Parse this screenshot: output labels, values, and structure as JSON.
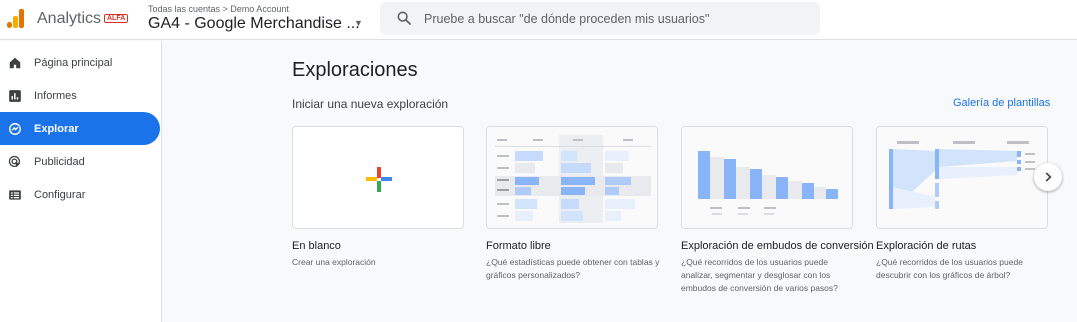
{
  "header": {
    "app_name": "Analytics",
    "badge": "ALFA",
    "breadcrumb": "Todas las cuentas > Demo Account",
    "account": "GA4 - Google Merchandise ...",
    "search_placeholder": "Pruebe a buscar \"de dónde proceden mis usuarios\""
  },
  "sidebar": {
    "items": [
      {
        "label": "Página principal",
        "icon": "home-icon"
      },
      {
        "label": "Informes",
        "icon": "bar-chart-icon"
      },
      {
        "label": "Explorar",
        "icon": "explore-icon",
        "active": true
      },
      {
        "label": "Publicidad",
        "icon": "advertising-icon"
      },
      {
        "label": "Configurar",
        "icon": "settings-list-icon"
      }
    ]
  },
  "main": {
    "title": "Exploraciones",
    "subtitle": "Iniciar una nueva exploración",
    "gallery_link": "Galería de plantillas",
    "cards": [
      {
        "title": "En blanco",
        "desc": "Crear una exploración"
      },
      {
        "title": "Formato libre",
        "desc": "¿Qué estadísticas puede obtener con tablas y gráficos personalizados?"
      },
      {
        "title": "Exploración de embudos de conversión",
        "desc": "¿Qué recorridos de los usuarios puede analizar, segmentar y desglosar con los embudos de conversión de varios pasos?"
      },
      {
        "title": "Exploración de rutas",
        "desc": "¿Qué recorridos de los usuarios puede descubrir con los gráficos de árbol?"
      }
    ]
  },
  "colors": {
    "accent": "#1a73e8",
    "red": "#ea4335",
    "yellow": "#fbbc04",
    "green": "#34a853"
  }
}
